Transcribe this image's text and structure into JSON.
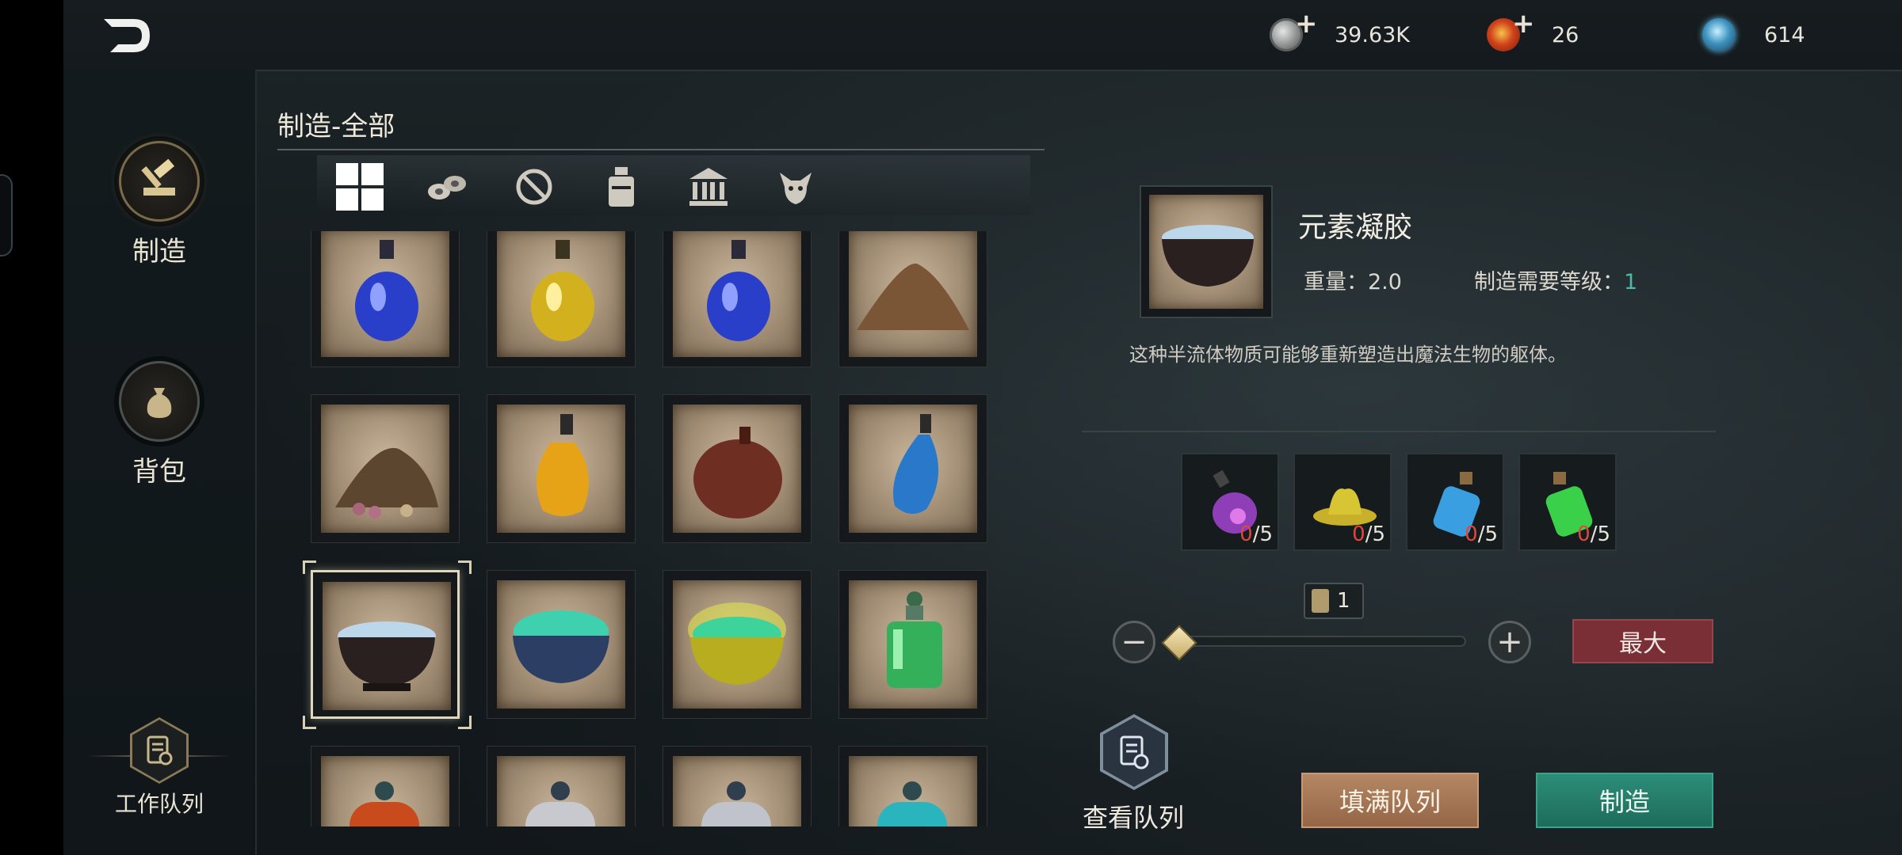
{
  "currencies": [
    {
      "icon": "silver-coin-icon",
      "value": "39.63K",
      "addable": true
    },
    {
      "icon": "red-gem-coin-icon",
      "value": "26",
      "addable": true
    },
    {
      "icon": "blue-orb-icon",
      "value": "614",
      "addable": false
    }
  ],
  "sidebar": {
    "items": [
      {
        "label": "制造",
        "icon": "hammer-anvil-icon",
        "active": true
      },
      {
        "label": "背包",
        "icon": "bag-icon",
        "active": false
      }
    ],
    "queue_label": "工作队列"
  },
  "craft": {
    "title": "制造-全部",
    "filters": [
      "all-grid-icon",
      "scrolls-icon",
      "no-weapon-icon",
      "potion-bottle-icon",
      "building-icon",
      "creature-head-icon"
    ],
    "items": [
      {
        "icon": "blue-potion-icon"
      },
      {
        "icon": "yellow-potion-icon"
      },
      {
        "icon": "blue-potion-icon"
      },
      {
        "icon": "sand-pile-icon"
      },
      {
        "icon": "seeds-pile-icon"
      },
      {
        "icon": "yellow-flask-icon"
      },
      {
        "icon": "leather-pouch-icon"
      },
      {
        "icon": "blue-flask-icon"
      },
      {
        "icon": "elemental-gel-bowl-icon",
        "selected": true
      },
      {
        "icon": "teal-gel-bowl-icon"
      },
      {
        "icon": "glowing-gel-bowl-icon"
      },
      {
        "icon": "green-bottle-icon"
      },
      {
        "icon": "red-jar-icon"
      },
      {
        "icon": "clear-jar-icon"
      },
      {
        "icon": "clear-jar-icon"
      },
      {
        "icon": "teal-jar-icon"
      }
    ]
  },
  "detail": {
    "name": "元素凝胶",
    "weight_label": "重量：2.0",
    "level_label": "制造需要等级：",
    "level_value": "1",
    "description": "这种半流体物质可能够重新塑造出魔法生物的躯体。",
    "materials": [
      {
        "icon": "purple-potion-icon",
        "have": "0",
        "need": "/5"
      },
      {
        "icon": "yellow-slime-icon",
        "have": "0",
        "need": "/5"
      },
      {
        "icon": "blue-vial-icon",
        "have": "0",
        "need": "/5"
      },
      {
        "icon": "green-vial-icon",
        "have": "0",
        "need": "/5"
      }
    ],
    "quantity": "1",
    "max_label": "最大",
    "view_queue_label": "查看队列",
    "fill_queue_label": "填满队列",
    "craft_label": "制造"
  }
}
